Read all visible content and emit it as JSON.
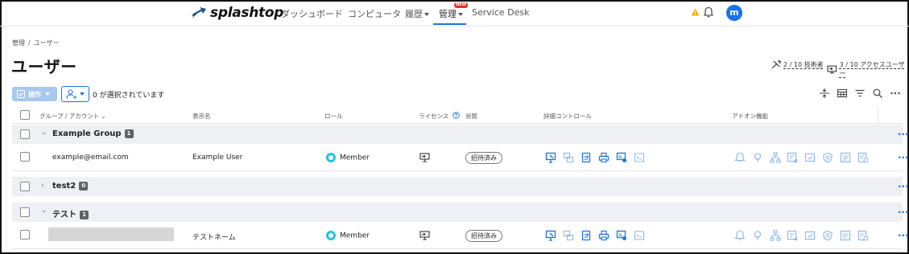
{
  "nav": {
    "logo_text": "splashtop",
    "items": [
      {
        "label": "ダッシュボード"
      },
      {
        "label": "コンピュータ"
      },
      {
        "label": "履歴"
      },
      {
        "label": "管理"
      },
      {
        "label": "Service Desk"
      }
    ],
    "new_badge": "NEW",
    "avatar_letter": "m"
  },
  "breadcrumb": {
    "parent": "管理",
    "separator": "/",
    "current": "ユーザー"
  },
  "page_title": "ユーザー",
  "seats": {
    "technicians": "2 / 10 技術者",
    "access_users": "3 / 10 アクセスユーザー"
  },
  "toolbar": {
    "actions_label": "操作",
    "selected_count": "0 が選択されています"
  },
  "table": {
    "headers": {
      "group_account": "グループ / アカウント",
      "display_name": "表示名",
      "role": "ロール",
      "license": "ライセンス",
      "status": "状態",
      "detail_controls": "詳細コントロール",
      "addons": "アドオン機能"
    },
    "groups": [
      {
        "name": "Example Group",
        "count": "1",
        "expanded": true,
        "users": [
          {
            "account": "example@email.com",
            "display_name": "Example User",
            "role": "Member",
            "status": "招待済み"
          }
        ]
      },
      {
        "name": "test2",
        "count": "0",
        "expanded": false,
        "users": []
      },
      {
        "name": "テスト",
        "count": "1",
        "expanded": true,
        "users": [
          {
            "account": "",
            "display_name": "テストネーム",
            "role": "Member",
            "status": "招待済み"
          }
        ]
      }
    ]
  },
  "colors": {
    "accent": "#1a73e8",
    "addon_icon": "#8ab4ea",
    "role_dot": "#21c4e0",
    "warning": "#f5b400",
    "new_badge": "#e8332a"
  }
}
